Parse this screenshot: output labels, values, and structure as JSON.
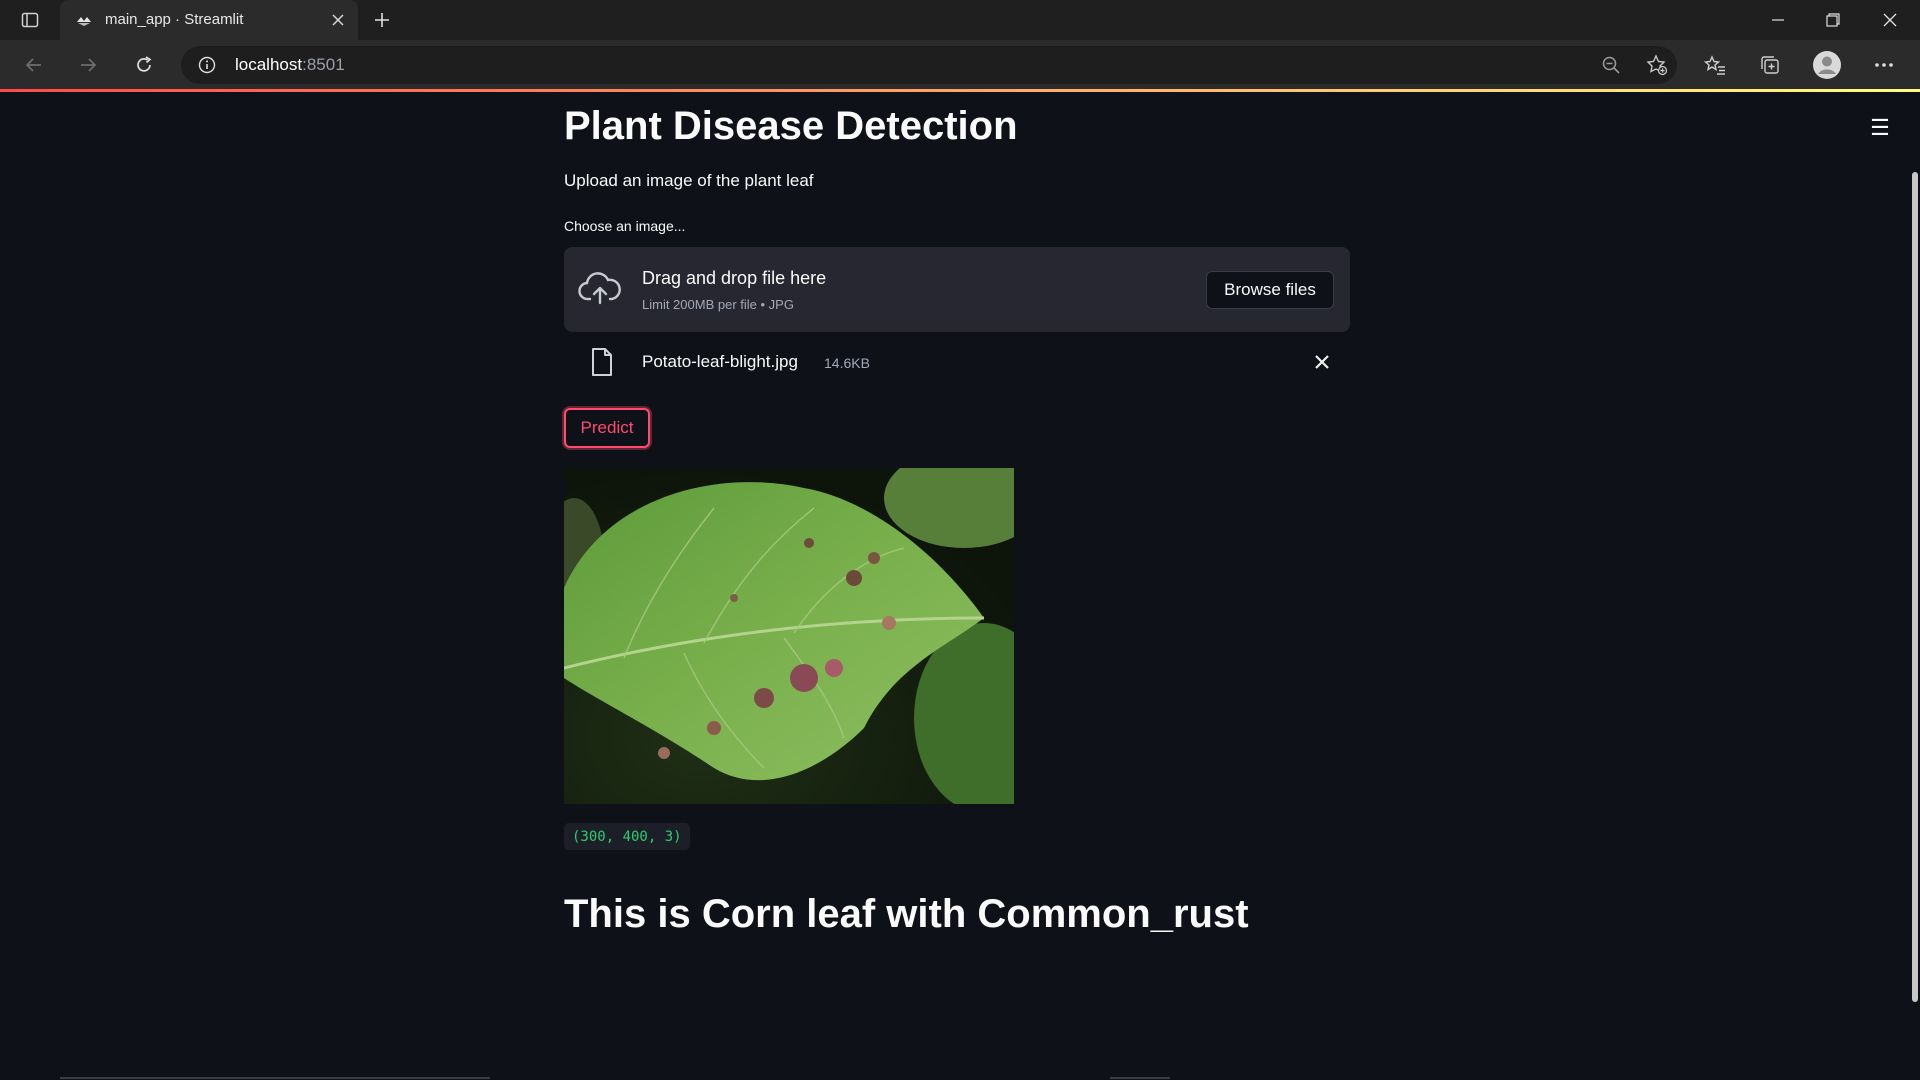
{
  "browser": {
    "tab_title": "main_app · Streamlit",
    "url_host": "localhost",
    "url_port": ":8501"
  },
  "app": {
    "title": "Plant Disease Detection",
    "subtitle": "Upload an image of the plant leaf",
    "uploader": {
      "label": "Choose an image...",
      "drop_text": "Drag and drop file here",
      "limit_text": "Limit 200MB per file • JPG",
      "browse_label": "Browse files"
    },
    "file": {
      "name": "Potato-leaf-blight.jpg",
      "size": "14.6KB"
    },
    "predict_label": "Predict",
    "shape_text": "(300, 400, 3)",
    "result_text": "This is Corn leaf with Common_rust"
  },
  "colors": {
    "background": "#0e1117",
    "accent": "#ff4b6e",
    "code_text": "#2ecc71",
    "dropzone_bg": "#262730"
  },
  "icons": [
    "tab-actions-icon",
    "streamlit-favicon",
    "close-icon",
    "plus-icon",
    "minimize-icon",
    "restore-icon",
    "back-icon",
    "forward-icon",
    "refresh-icon",
    "info-icon",
    "zoom-out-icon",
    "favorite-add-icon",
    "favorites-icon",
    "collections-icon",
    "profile-icon",
    "more-icon",
    "hamburger-icon",
    "cloud-upload-icon",
    "file-icon"
  ]
}
